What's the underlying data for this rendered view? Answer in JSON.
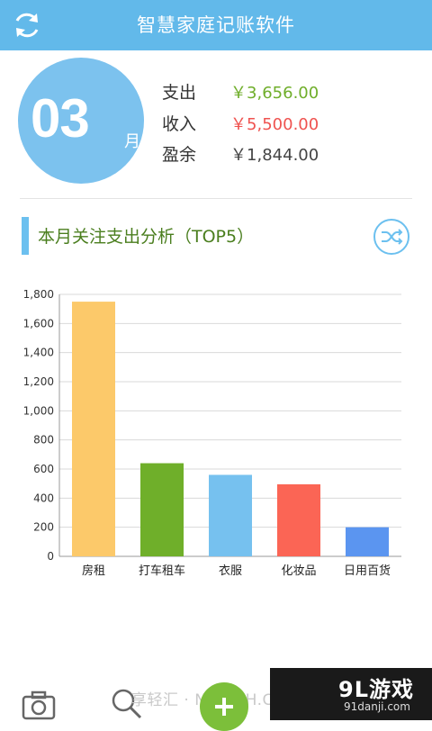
{
  "header": {
    "title": "智慧家庭记账软件",
    "refresh_icon": "refresh-icon"
  },
  "month": {
    "number": "03",
    "unit": "月"
  },
  "summary": [
    {
      "label": "支出",
      "value": "￥3,656.00",
      "color": "#6fae2a"
    },
    {
      "label": "收入",
      "value": "￥5,500.00",
      "color": "#ef5350"
    },
    {
      "label": "盈余",
      "value": "￥1,844.00",
      "color": "#444444"
    }
  ],
  "section": {
    "title": "本月关注支出分析（TOP5）",
    "shuffle_icon": "shuffle-icon"
  },
  "chart_data": {
    "type": "bar",
    "categories": [
      "房租",
      "打车租车",
      "衣服",
      "化妆品",
      "日用百货"
    ],
    "values": [
      1750,
      640,
      560,
      495,
      200
    ],
    "colors": [
      "#fcc96a",
      "#6faf2a",
      "#76c1ef",
      "#fb6555",
      "#5b95f0"
    ],
    "ylim": [
      0,
      1800
    ],
    "yticks": [
      "0",
      "200",
      "400",
      "600",
      "800",
      "1,000",
      "1,200",
      "1,400",
      "1,600",
      "1,800"
    ],
    "grid": true,
    "title": "",
    "xlabel": "",
    "ylabel": ""
  },
  "bottom": {
    "camera_icon": "camera-icon",
    "search_icon": "search-icon",
    "add_icon": "add-icon",
    "watermark_text": "享轻汇 · NIYOOH.COM",
    "badge_title": "9L游戏",
    "badge_url": "91danji.com"
  }
}
